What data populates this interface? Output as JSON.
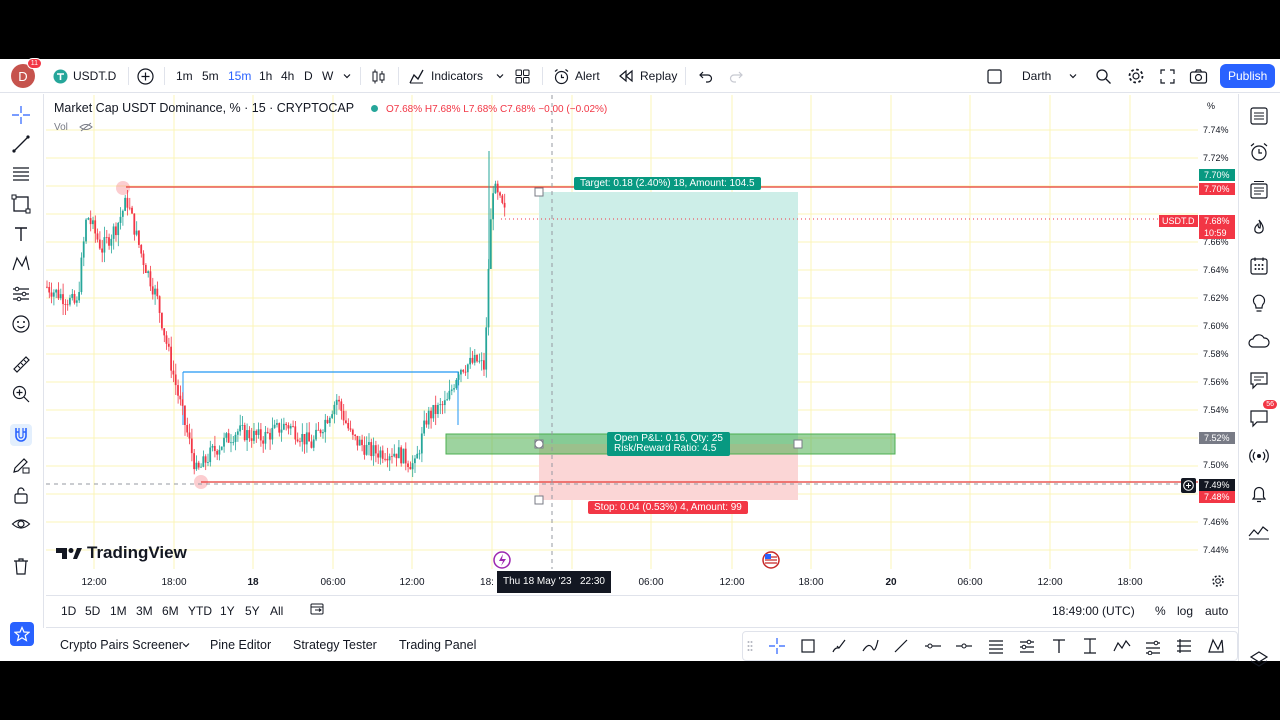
{
  "topbar": {
    "avatar_letter": "D",
    "avatar_badge": "11",
    "symbol": "USDT.D",
    "intervals": [
      "1m",
      "5m",
      "15m",
      "1h",
      "4h",
      "D",
      "W"
    ],
    "active_interval": "15m",
    "indicators_label": "Indicators",
    "alert_label": "Alert",
    "replay_label": "Replay",
    "layout_name": "Darth",
    "publish_label": "Publish"
  },
  "legend": {
    "title": "Market Cap USDT Dominance, % · 15 · CRYPTOCAP",
    "ohlc": "O7.68% H7.68% L7.68% C7.68% −0.00 (−0.02%)",
    "vol": "Vol"
  },
  "price_axis": {
    "unit": "%",
    "ticks": [
      "7.74%",
      "7.72%",
      "7.68%",
      "7.66%",
      "7.64%",
      "7.62%",
      "7.60%",
      "7.58%",
      "7.56%",
      "7.54%",
      "7.50%",
      "7.46%",
      "7.44%"
    ],
    "tags": {
      "target_top": "7.70%",
      "target_line": "7.70%",
      "current_price": "7.68%",
      "countdown": "10:59",
      "symbol_tag": "USDT.D",
      "entry": "7.52%",
      "crosshair": "7.49%",
      "stop": "7.48%"
    }
  },
  "time_axis": {
    "ticks": [
      "12:00",
      "18:00",
      "18",
      "06:00",
      "12:00",
      "18:",
      "06:00",
      "12:00",
      "18:00",
      "20",
      "06:00",
      "12:00",
      "18:00"
    ],
    "crosshair_label": "Thu 18 May '23   22:30"
  },
  "position": {
    "target_label": "Target: 0.18 (2.40%) 18, Amount: 104.5",
    "pnl_label": "Open P&L: 0.16, Qty: 25",
    "rr_label": "Risk/Reward Ratio: 4.5",
    "stop_label": "Stop: 0.04 (0.53%) 4, Amount: 99"
  },
  "watermark": "TradingView",
  "range_bar": {
    "ranges": [
      "1D",
      "5D",
      "1M",
      "3M",
      "6M",
      "YTD",
      "1Y",
      "5Y",
      "All"
    ],
    "clock": "18:49:00 (UTC)",
    "pct": "%",
    "log": "log",
    "auto": "auto"
  },
  "bottom_tabs": [
    "Crypto Pairs Screener",
    "Pine Editor",
    "Strategy Tester",
    "Trading Panel"
  ],
  "right_badge": "56",
  "colors": {
    "accent": "#2962ff",
    "up": "#26a69a",
    "down": "#f23645",
    "target_fill": "#cdeee8",
    "stop_fill": "#fbd6d6",
    "grid": "#fbf4b8"
  }
}
